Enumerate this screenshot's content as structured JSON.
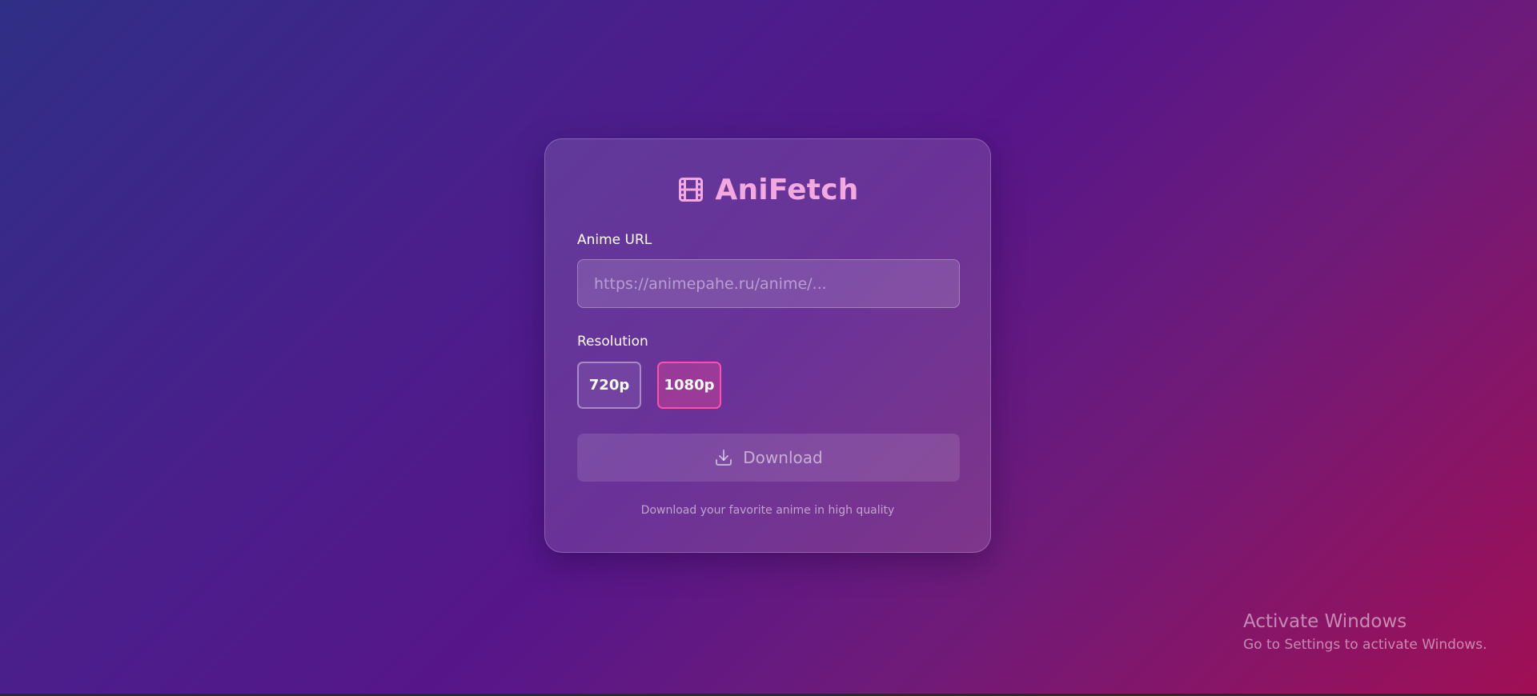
{
  "app": {
    "title": "AniFetch",
    "icon": "film-icon",
    "accent_color": "#f3a8df"
  },
  "form": {
    "url_label": "Anime URL",
    "url_placeholder": "https://animepahe.ru/anime/...",
    "url_value": "",
    "resolution_label": "Resolution",
    "resolution_options": [
      {
        "label": "720p",
        "selected": false
      },
      {
        "label": "1080p",
        "selected": true
      }
    ],
    "selected_border_color": "#ff4fa8",
    "download_label": "Download",
    "download_icon": "download-icon",
    "footer": "Download your favorite anime in high quality"
  },
  "system_watermark": {
    "title": "Activate Windows",
    "subtitle": "Go to Settings to activate Windows."
  }
}
